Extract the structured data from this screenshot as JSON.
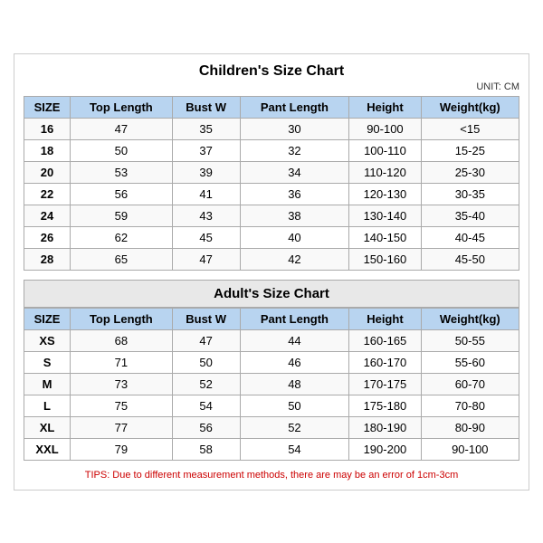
{
  "title": "Children's Size Chart",
  "unit": "UNIT: CM",
  "children": {
    "columns": [
      "SIZE",
      "Top Length",
      "Bust W",
      "Pant Length",
      "Height",
      "Weight(kg)"
    ],
    "rows": [
      [
        "16",
        "47",
        "35",
        "30",
        "90-100",
        "<15"
      ],
      [
        "18",
        "50",
        "37",
        "32",
        "100-110",
        "15-25"
      ],
      [
        "20",
        "53",
        "39",
        "34",
        "110-120",
        "25-30"
      ],
      [
        "22",
        "56",
        "41",
        "36",
        "120-130",
        "30-35"
      ],
      [
        "24",
        "59",
        "43",
        "38",
        "130-140",
        "35-40"
      ],
      [
        "26",
        "62",
        "45",
        "40",
        "140-150",
        "40-45"
      ],
      [
        "28",
        "65",
        "47",
        "42",
        "150-160",
        "45-50"
      ]
    ]
  },
  "adult_title": "Adult's Size Chart",
  "adult": {
    "columns": [
      "SIZE",
      "Top Length",
      "Bust W",
      "Pant Length",
      "Height",
      "Weight(kg)"
    ],
    "rows": [
      [
        "XS",
        "68",
        "47",
        "44",
        "160-165",
        "50-55"
      ],
      [
        "S",
        "71",
        "50",
        "46",
        "160-170",
        "55-60"
      ],
      [
        "M",
        "73",
        "52",
        "48",
        "170-175",
        "60-70"
      ],
      [
        "L",
        "75",
        "54",
        "50",
        "175-180",
        "70-80"
      ],
      [
        "XL",
        "77",
        "56",
        "52",
        "180-190",
        "80-90"
      ],
      [
        "XXL",
        "79",
        "58",
        "54",
        "190-200",
        "90-100"
      ]
    ]
  },
  "tips": "TIPS: Due to different measurement methods, there are may be an error of 1cm-3cm"
}
